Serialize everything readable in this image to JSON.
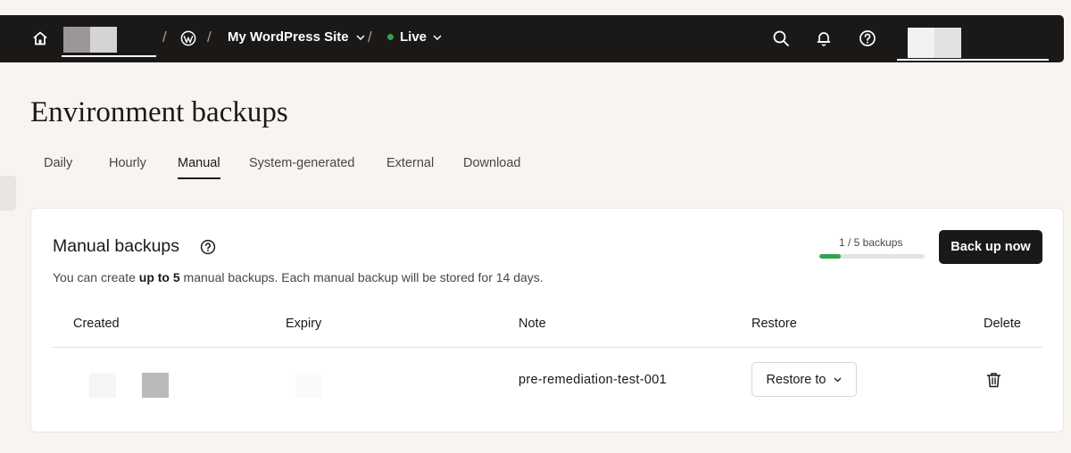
{
  "topbar": {
    "site_name": "My WordPress Site",
    "environment": "Live",
    "environment_status_color": "#2fa34f",
    "icons": [
      "home-icon",
      "wordpress-icon",
      "search-icon",
      "bell-icon",
      "help-icon"
    ]
  },
  "page": {
    "title": "Environment backups"
  },
  "tabs": [
    {
      "label": "Daily",
      "active": false
    },
    {
      "label": "Hourly",
      "active": false
    },
    {
      "label": "Manual",
      "active": true
    },
    {
      "label": "System-generated",
      "active": false
    },
    {
      "label": "External",
      "active": false
    },
    {
      "label": "Download",
      "active": false
    }
  ],
  "card": {
    "title": "Manual backups",
    "desc_prefix": "You can create ",
    "desc_bold": "up to 5",
    "desc_suffix": " manual backups. Each manual backup will be stored for 14 days.",
    "usage_label": "1 / 5 backups",
    "usage_fraction": 0.2,
    "backup_button": "Back up now"
  },
  "table": {
    "headers": [
      "Created",
      "Expiry",
      "Note",
      "Restore",
      "Delete"
    ],
    "rows": [
      {
        "note": "pre-remediation-test-001",
        "restore_label": "Restore to"
      }
    ]
  },
  "colors": {
    "accent_dark": "#1b1918",
    "success": "#2fa34f",
    "background": "#f8f4f0"
  }
}
